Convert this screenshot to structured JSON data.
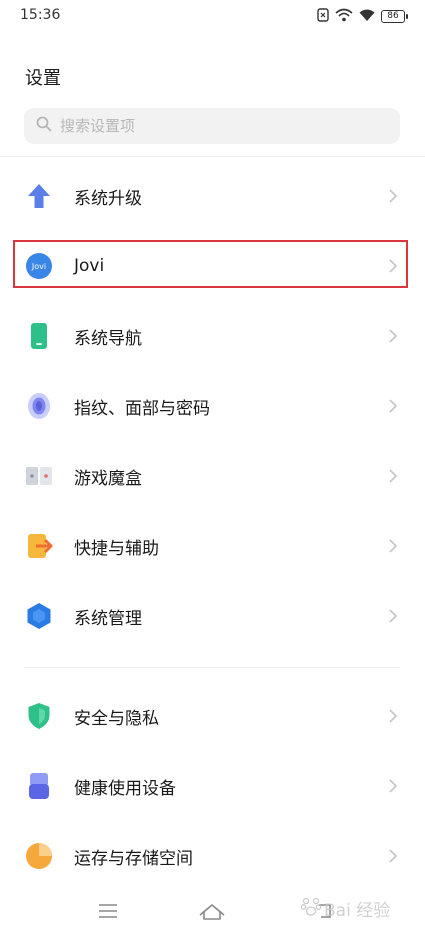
{
  "status_bar": {
    "time": "15:36",
    "battery": "86"
  },
  "header": {
    "title": "设置"
  },
  "search": {
    "placeholder": "搜索设置项"
  },
  "items": [
    {
      "label": "系统升级",
      "icon": "upgrade-arrow-icon"
    },
    {
      "label": "Jovi",
      "icon": "jovi-icon",
      "icon_text": "Jovi"
    },
    {
      "label": "系统导航",
      "icon": "phone-navigation-icon"
    },
    {
      "label": "指纹、面部与密码",
      "icon": "fingerprint-icon"
    },
    {
      "label": "游戏魔盒",
      "icon": "game-box-icon"
    },
    {
      "label": "快捷与辅助",
      "icon": "shortcut-icon"
    },
    {
      "label": "系统管理",
      "icon": "system-management-icon"
    },
    {
      "label": "安全与隐私",
      "icon": "security-shield-icon"
    },
    {
      "label": "健康使用设备",
      "icon": "health-usage-icon"
    },
    {
      "label": "运存与存储空间",
      "icon": "storage-pie-icon"
    }
  ],
  "watermark": {
    "text": "Bai 经验"
  },
  "colors": {
    "highlight_border": "#d9363e",
    "search_bg": "#f2f2f2"
  }
}
